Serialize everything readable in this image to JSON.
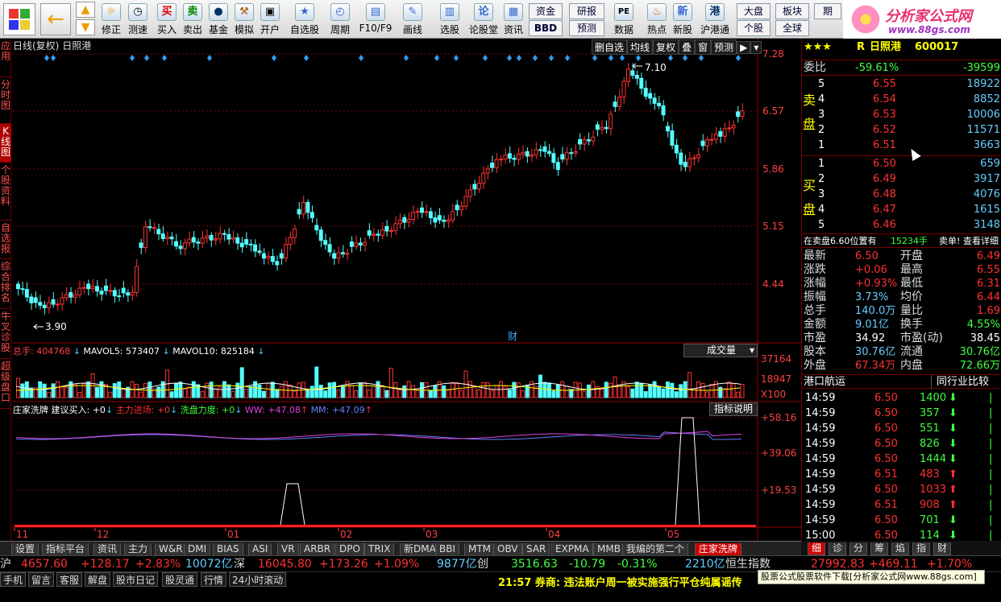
{
  "toolbar": {
    "buttons": [
      "",
      "",
      "修正",
      "测速",
      "买入",
      "卖出",
      "基金",
      "模拟",
      "开户",
      "自选股",
      "周期",
      "F10/F9",
      "画线",
      "选股",
      "论股堂",
      "资讯",
      "数据",
      "热点",
      "新股",
      "沪港通"
    ],
    "boxes": [
      "资金",
      "BBD",
      "研报",
      "预测",
      "大盘",
      "个股",
      "板块",
      "全球",
      "期"
    ],
    "icons": [
      "☺",
      "←",
      "↑",
      "⏻",
      "⏲",
      "买",
      "卖",
      "●",
      "⚒",
      "⚿",
      "★",
      "⏱",
      "▤",
      "✎",
      "▣",
      "论",
      "▥",
      "PE",
      "♨",
      "新",
      "港"
    ]
  },
  "logo": {
    "name": "分析家公式网",
    "url": "www.88gs.com"
  },
  "chart": {
    "title": "日线(复权)",
    "stock": "日照港",
    "top_buttons": [
      "删自选",
      "均线",
      "复权",
      "叠",
      "窗",
      "预测"
    ],
    "price_axis": [
      "7.28",
      "6.57",
      "5.86",
      "5.15",
      "4.44"
    ],
    "max_label": "7.10",
    "min_label": "3.90",
    "fin_label": "财",
    "vol_axis": [
      "37164",
      "18947",
      "X100"
    ],
    "ind_axis": [
      "+58.16",
      "+39.06",
      "+19.53"
    ],
    "x_labels": [
      "11",
      "12",
      "01",
      "02",
      "03",
      "04",
      "05"
    ],
    "vol_line": {
      "total": "总手: 404768",
      "mavol5": "MAVOL5: 573407",
      "mavol10": "MAVOL10: 825184",
      "selector": "成交量"
    },
    "ind_line": {
      "name": "庄家洗牌",
      "suggest": "建议买入: +0",
      "main": "主力进场: +0",
      "wash": "洗盘力度: +0",
      "ww": "WW: +47.08",
      "mm": "MM: +47.09",
      "help": "指标说明"
    },
    "chart_data": {
      "type": "candlestick",
      "x_months": [
        "11",
        "12",
        "01",
        "02",
        "03",
        "04",
        "05"
      ],
      "ylim": [
        3.7,
        7.28
      ],
      "high": 7.1,
      "low": 3.9
    }
  },
  "left_tabs": [
    "应用",
    "分时图",
    "K线图",
    "个股资料",
    "自选报",
    "综合排名",
    "牛叉诊股",
    "超级盘口"
  ],
  "quote": {
    "stars": "★★★",
    "rlabel": "R",
    "name": "日照港",
    "code": "600017",
    "wb_label": "委比",
    "wb": "-59.61%",
    "wb_val": "-39599",
    "sell_label": "卖盘",
    "buy_label": "买盘",
    "sell": [
      {
        "n": "5",
        "p": "6.55",
        "v": "18922"
      },
      {
        "n": "4",
        "p": "6.54",
        "v": "8852"
      },
      {
        "n": "3",
        "p": "6.53",
        "v": "10006"
      },
      {
        "n": "2",
        "p": "6.52",
        "v": "11571"
      },
      {
        "n": "1",
        "p": "6.51",
        "v": "3663"
      }
    ],
    "buy": [
      {
        "n": "1",
        "p": "6.50",
        "v": "659"
      },
      {
        "n": "2",
        "p": "6.49",
        "v": "3917"
      },
      {
        "n": "3",
        "p": "6.48",
        "v": "4076"
      },
      {
        "n": "4",
        "p": "6.47",
        "v": "1615"
      },
      {
        "n": "5",
        "p": "6.46",
        "v": "3148"
      }
    ],
    "notice": "在卖盘6.60位置有",
    "notice_vol": "15234手",
    "notice_tail": "卖单!",
    "detail": "查看详细",
    "stats": [
      {
        "k": "最新",
        "v": "6.50",
        "k2": "开盘",
        "v2": "6.49"
      },
      {
        "k": "涨跌",
        "v": "+0.06",
        "k2": "最高",
        "v2": "6.55"
      },
      {
        "k": "涨幅",
        "v": "+0.93%",
        "k2": "最低",
        "v2": "6.31"
      },
      {
        "k": "振幅",
        "v": "3.73%",
        "k2": "均价",
        "v2": "6.44"
      },
      {
        "k": "总手",
        "v": "140.0万",
        "k2": "量比",
        "v2": "1.69"
      },
      {
        "k": "金额",
        "v": "9.01亿",
        "k2": "换手",
        "v2": "4.55%"
      },
      {
        "k": "市盈",
        "v": "34.92",
        "k2": "市盈(动)",
        "v2": "38.45"
      },
      {
        "k": "股本",
        "v": "30.76亿",
        "k2": "流通",
        "v2": "30.76亿"
      },
      {
        "k": "外盘",
        "v": "67.34万",
        "k2": "内盘",
        "v2": "72.66万"
      }
    ],
    "industry": "港口航运",
    "peer": "同行业比较",
    "ticks": [
      {
        "t": "14:59",
        "p": "6.50",
        "v": "1400",
        "d": "down"
      },
      {
        "t": "14:59",
        "p": "6.50",
        "v": "357",
        "d": "down"
      },
      {
        "t": "14:59",
        "p": "6.50",
        "v": "551",
        "d": "down"
      },
      {
        "t": "14:59",
        "p": "6.50",
        "v": "826",
        "d": "down"
      },
      {
        "t": "14:59",
        "p": "6.50",
        "v": "1444",
        "d": "down"
      },
      {
        "t": "14:59",
        "p": "6.51",
        "v": "483",
        "d": "up"
      },
      {
        "t": "14:59",
        "p": "6.50",
        "v": "1033",
        "d": "up"
      },
      {
        "t": "14:59",
        "p": "6.51",
        "v": "908",
        "d": "up"
      },
      {
        "t": "14:59",
        "p": "6.50",
        "v": "701",
        "d": "down"
      },
      {
        "t": "15:00",
        "p": "6.50",
        "v": "114",
        "d": "down"
      }
    ],
    "right_tabs": [
      "细",
      "诊",
      "分",
      "筹",
      "焰",
      "指",
      "财"
    ]
  },
  "bottom_tabs": [
    "设置",
    "指标平台",
    "资讯",
    "主力",
    "W&R",
    "DMI",
    "BIAS",
    "ASI",
    "VR",
    "ARBR",
    "DPO",
    "TRIX",
    "新DMA",
    "BBI",
    "MTM",
    "OBV",
    "SAR",
    "EXPMA",
    "MMB",
    "我编的第二个",
    "庄家洗牌"
  ],
  "status": {
    "a_label": "沪",
    "a1": "4657.60",
    "a2": "+128.17",
    "a3": "+2.83%",
    "a4": "10072亿",
    "b_label": "深",
    "b1": "16045.80",
    "b2": "+173.26",
    "b3": "+1.09%",
    "b4": "9877亿",
    "c_label": "创",
    "c1": "3516.63",
    "c2": "-10.79",
    "c3": "-0.31%",
    "c4": "2210亿",
    "d_label": "恒生指数",
    "d1": "27992.83",
    "d2": "+469.11",
    "d3": "+1.70%"
  },
  "status2": {
    "buttons": [
      "手机",
      "留言",
      "客服",
      "解盘",
      "股市日记",
      "股灵通",
      "行情",
      "24小时滚动"
    ],
    "news": "21:57 券商: 违法账户周一被实施强行平仓纯属谣传",
    "promo": "股票公式股票软件下载[分析家公式网www.88gs.com]"
  }
}
